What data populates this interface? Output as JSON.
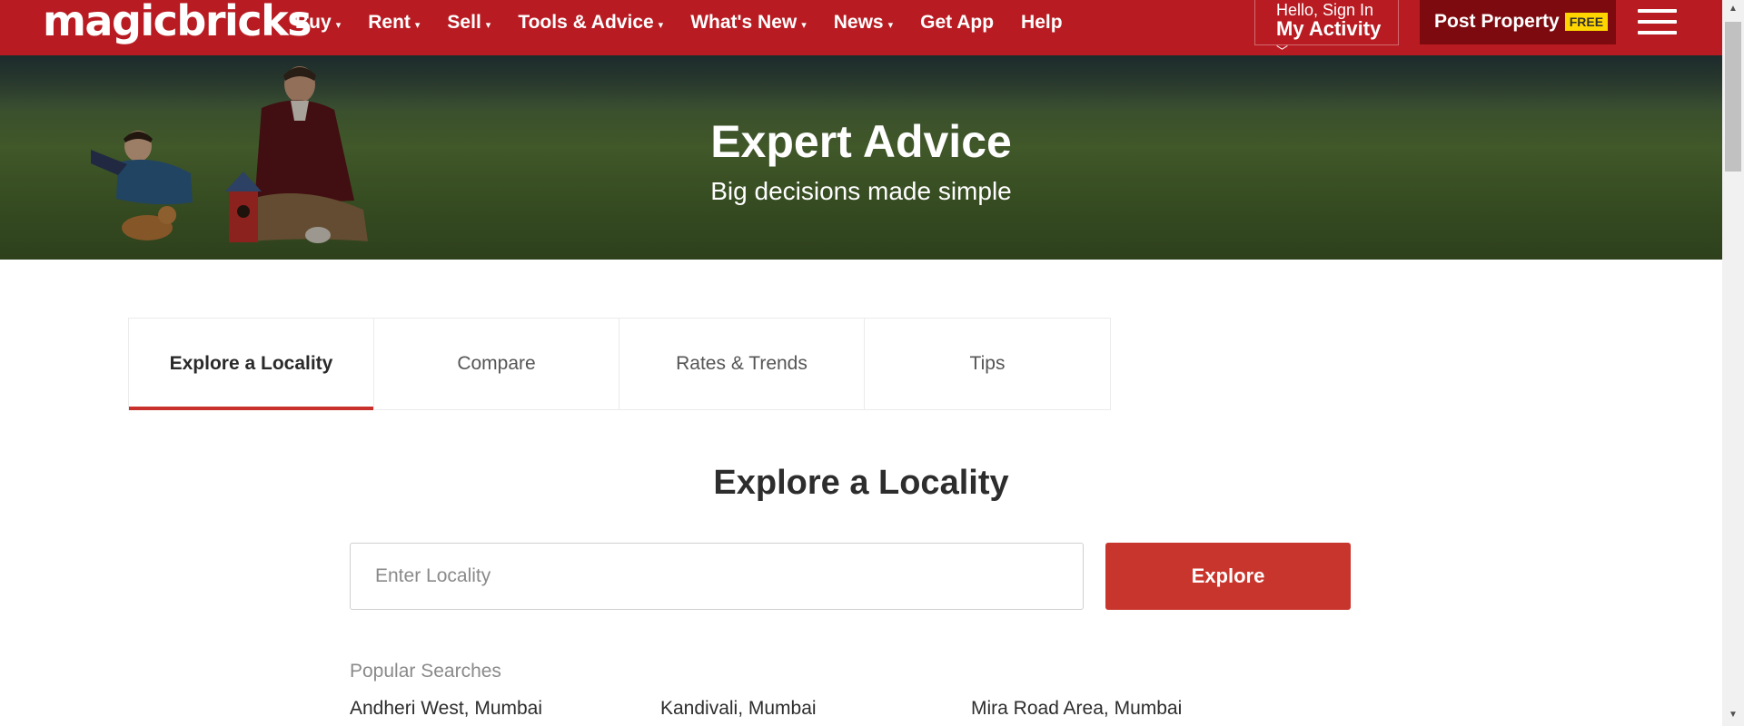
{
  "header": {
    "logo": "magicbricks",
    "nav": [
      {
        "label": "Buy",
        "dropdown": true
      },
      {
        "label": "Rent",
        "dropdown": true
      },
      {
        "label": "Sell",
        "dropdown": true
      },
      {
        "label": "Tools & Advice",
        "dropdown": true
      },
      {
        "label": "What's New",
        "dropdown": true
      },
      {
        "label": "News",
        "dropdown": true
      },
      {
        "label": "Get App",
        "dropdown": false
      },
      {
        "label": "Help",
        "dropdown": false
      }
    ],
    "signin_greeting": "Hello, Sign In",
    "signin_activity": "My Activity",
    "post_property": "Post Property",
    "post_badge": "FREE",
    "brand_color": "#b81c22"
  },
  "banner": {
    "title": "Expert Advice",
    "subtitle": "Big decisions made simple"
  },
  "tabs": [
    {
      "label": "Explore a Locality",
      "active": true
    },
    {
      "label": "Compare",
      "active": false
    },
    {
      "label": "Rates & Trends",
      "active": false
    },
    {
      "label": "Tips",
      "active": false
    }
  ],
  "explore": {
    "title": "Explore a Locality",
    "input_placeholder": "Enter Locality",
    "input_value": "",
    "button_label": "Explore",
    "button_color": "#c8352c",
    "popular_label": "Popular Searches",
    "popular": [
      "Andheri West, Mumbai",
      "Kandivali, Mumbai",
      "Mira Road Area, Mumbai"
    ]
  }
}
